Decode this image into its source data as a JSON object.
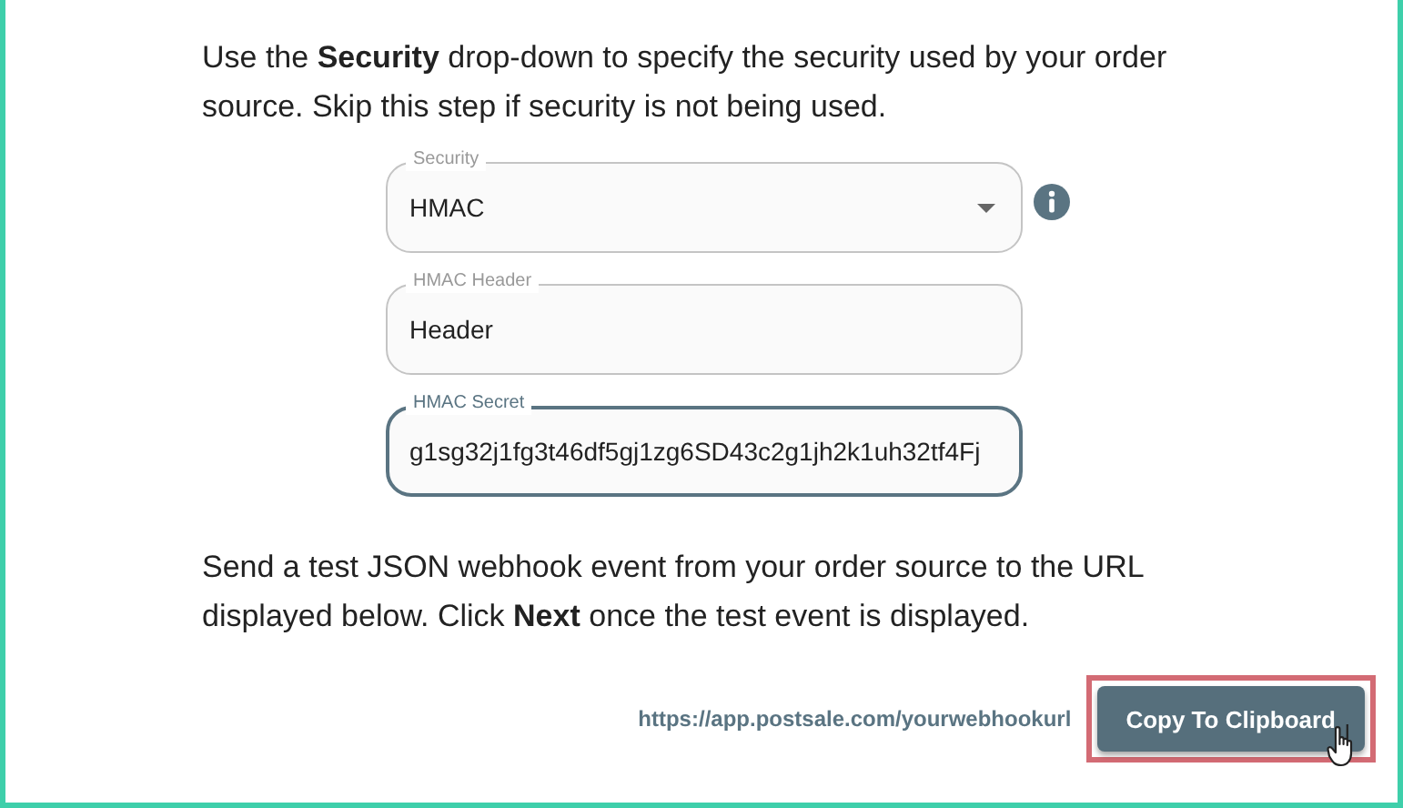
{
  "intro": "Use the **Security** drop-down to specify the security used by your order source. Skip this step if security is not being used.",
  "fields": [
    {
      "kind": "select",
      "label": "Security",
      "value": "HMAC",
      "focused": false,
      "info": true
    },
    {
      "kind": "text",
      "label": "HMAC Header",
      "value": "Header",
      "focused": false,
      "info": false
    },
    {
      "kind": "text",
      "label": "HMAC Secret",
      "value": "g1sg32j1fg3t46df5gj1zg6SD43c2g1jh2k1uh32tf4Fj",
      "focused": true,
      "info": false
    }
  ],
  "instructions": "Send a test JSON webhook event from your order source to the URL displayed below. Click **Next** once the test event is displayed.",
  "webhook_url": "https://app.postsale.com/yourwebhookurl",
  "copy_button": {
    "label": "Copy To Clipboard",
    "highlighted": true
  }
}
